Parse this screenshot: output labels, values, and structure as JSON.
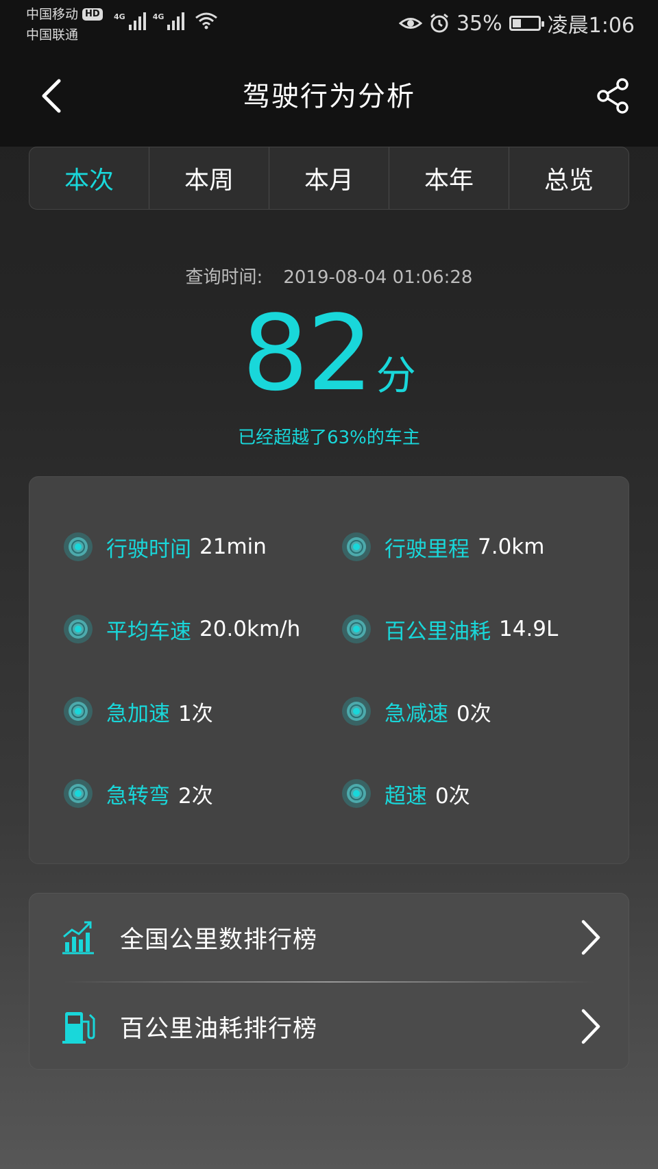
{
  "status_bar": {
    "carrier_1": "中国移动",
    "hd_badge": "HD",
    "carrier_2": "中国联通",
    "network_1": "4G",
    "network_2": "4G",
    "battery": "35%",
    "battery_level": 0.35,
    "time": "凌晨1:06",
    "icons": [
      "eye-icon",
      "alarm-icon",
      "battery-icon",
      "wifi-icon"
    ]
  },
  "header": {
    "title": "驾驶行为分析",
    "back_icon": "back-icon",
    "share_icon": "share-icon"
  },
  "tabs": [
    {
      "label": "本次",
      "active": true
    },
    {
      "label": "本周",
      "active": false
    },
    {
      "label": "本月",
      "active": false
    },
    {
      "label": "本年",
      "active": false
    },
    {
      "label": "总览",
      "active": false
    }
  ],
  "summary": {
    "query_label": "查询时间:",
    "query_value": "2019-08-04 01:06:28",
    "score": "82",
    "score_unit": "分",
    "beat_text": "已经超越了63%的车主"
  },
  "stats": [
    {
      "label": "行驶时间",
      "value": "21min"
    },
    {
      "label": "行驶里程",
      "value": "7.0km"
    },
    {
      "label": "平均车速",
      "value": "20.0km/h"
    },
    {
      "label": "百公里油耗",
      "value": "14.9L"
    },
    {
      "label": "急加速",
      "value": "1次"
    },
    {
      "label": "急减速",
      "value": "0次"
    },
    {
      "label": "急转弯",
      "value": "2次"
    },
    {
      "label": "超速",
      "value": "0次"
    }
  ],
  "rankings": [
    {
      "label": "全国公里数排行榜",
      "icon": "chart-icon"
    },
    {
      "label": "百公里油耗排行榜",
      "icon": "fuel-pump-icon"
    }
  ],
  "colors": {
    "accent": "#19d7da",
    "header_bg": "#121212",
    "card_bg": "#434343"
  }
}
